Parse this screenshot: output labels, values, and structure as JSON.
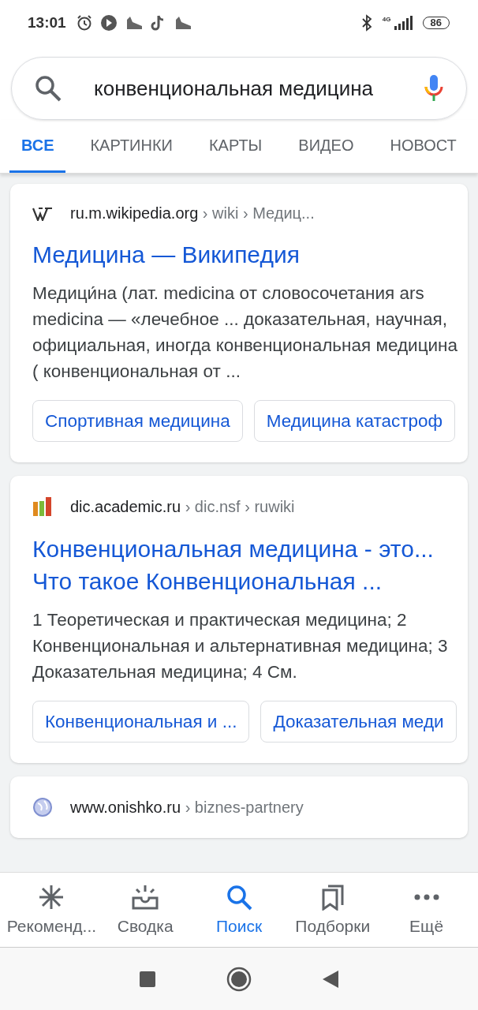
{
  "status_bar": {
    "time": "13:01",
    "network": "4G",
    "battery": "86"
  },
  "search": {
    "value": "конвенциональная медицина"
  },
  "tabs": [
    {
      "label": "ВСЕ",
      "selected": true
    },
    {
      "label": "КАРТИНКИ",
      "selected": false
    },
    {
      "label": "КАРТЫ",
      "selected": false
    },
    {
      "label": "ВИДЕО",
      "selected": false
    },
    {
      "label": "НОВОСТ",
      "selected": false
    }
  ],
  "results": [
    {
      "site": "ru.m.wikipedia.org",
      "path": "› wiki › Медиц...",
      "title_lines": [
        "Медицина — Википедия"
      ],
      "snippet": "Медици́на (лат. medicina от словосочетания ars medicina — «лечебное ... доказательная, научная, официальная, иногда конвенциональная медицина ( конвенциональная от ...",
      "chips": [
        "Спортивная медицина",
        "Медицина катастроф"
      ]
    },
    {
      "site": "dic.academic.ru",
      "path": "› dic.nsf › ruwiki",
      "title_lines": [
        "Конвенциональная медицина - это...",
        "Что такое Конвенциональная ..."
      ],
      "snippet": "1 Теоретическая и практическая медицина; 2 Конвенциональная и альтернативная медицина; 3 Доказательная медицина; 4 См.",
      "chips": [
        "Конвенциональная и ...",
        "Доказательная меди"
      ]
    },
    {
      "site": "www.onishko.ru",
      "path": "› biznes-partnery"
    }
  ],
  "bottom_nav": [
    {
      "label": "Рекоменд...",
      "selected": false
    },
    {
      "label": "Сводка",
      "selected": false
    },
    {
      "label": "Поиск",
      "selected": true
    },
    {
      "label": "Подборки",
      "selected": false
    },
    {
      "label": "Ещё",
      "selected": false
    }
  ]
}
